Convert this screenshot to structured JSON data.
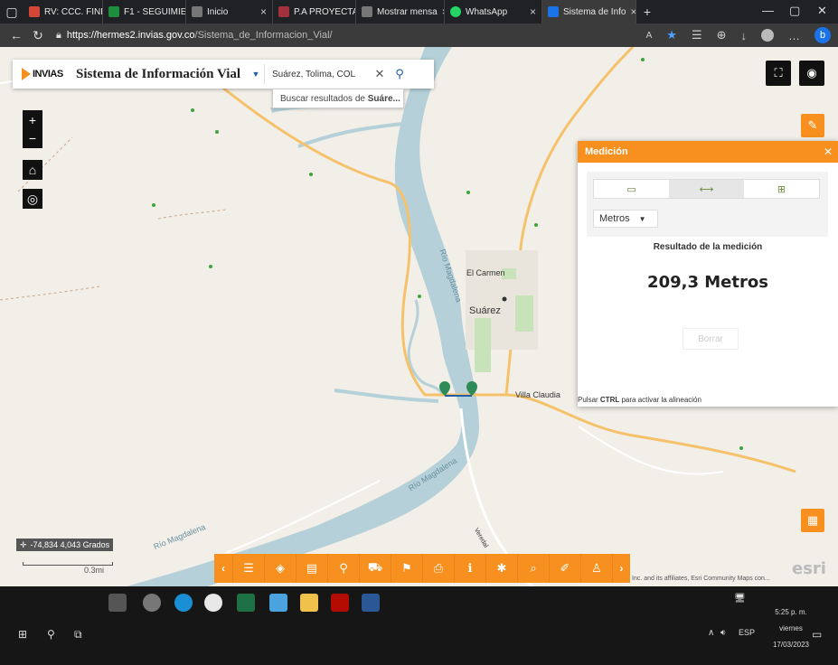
{
  "browser": {
    "tabs": [
      {
        "title": "RV: CCC. FINDE",
        "icon_color": "#d44638"
      },
      {
        "title": "F1 - SEGUIMIE",
        "icon_color": "#1e8e3e"
      },
      {
        "title": "Inicio",
        "icon_color": "#777777"
      },
      {
        "title": "P.A PROYECTA",
        "icon_color": "#a3313c"
      },
      {
        "title": "Mostrar mensa",
        "icon_color": "#777777"
      },
      {
        "title": "WhatsApp",
        "icon_color": "#25d366"
      },
      {
        "title": "Sistema de Info",
        "icon_color": "#1a73e8"
      }
    ],
    "url_host": "https://hermes2.invias.gov.co",
    "url_path": "/Sistema_de_Informacion_Vial/"
  },
  "app": {
    "logo_text": "INVIAS",
    "title": "Sistema de Información Vial",
    "search_value": "Suárez, Tolima, COL",
    "suggestion_prefix": "Buscar resultados de ",
    "suggestion_bold": "Suáre...",
    "accent_color": "#f7901e"
  },
  "map": {
    "labels": {
      "el_carmen": "El Carmen",
      "suarez": "Suárez",
      "villa_claudia": "Villa Claudia",
      "rio_magdalena_1": "Río Magdalena",
      "rio_magdalena_2": "Río Magdalena",
      "rio_magdalena_3": "Río Magdalena",
      "veredal": "Veredal"
    },
    "coordinates": "-74,834 4,043 Grados",
    "scale": "0.3mi",
    "attribution": "Inc. and its affiliates, Esri Community Maps con...",
    "esri": "esri"
  },
  "measurement": {
    "title": "Medición",
    "units": "Metros",
    "result_label": "Resultado de la medición",
    "result_value": "209,3 Metros",
    "clear_button": "Borrar",
    "hint_prefix": "Pulsar ",
    "hint_key": "CTRL",
    "hint_suffix": " para activar la alineación"
  },
  "taskbar": {
    "time": "5:25 p. m.",
    "day": "viernes",
    "date": "17/03/2023",
    "lang": "ESP"
  }
}
